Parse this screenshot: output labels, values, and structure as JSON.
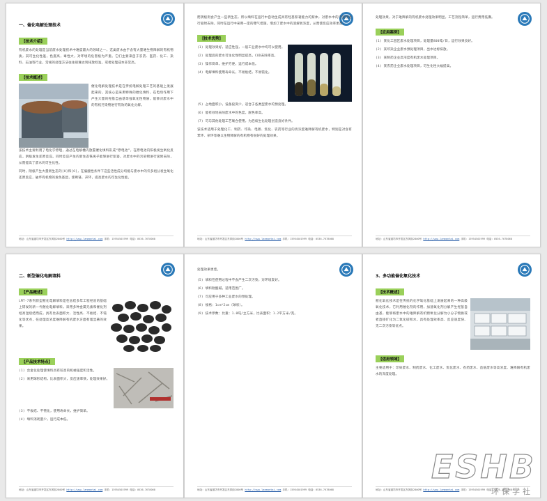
{
  "header_logo": "company-logo",
  "footer": {
    "prefix": "地址：",
    "address": "山东省潍坊市开发区东风街2800号",
    "contact_label": "联系人：",
    "url": "http://www.lanmantai.com",
    "phone_label": "手机：",
    "phone": "15954501999",
    "tel_label": "电话：",
    "tel": "0536-7678068"
  },
  "pages": {
    "p1": {
      "section": "一、催化电解处理技术",
      "tech_intro_label": "【技术介绍】",
      "intro_text": "有机废水的处理是当前废水处理技术中难度最大的领域之一，这类废水由于含有大量难生物降解的有机物质，其可生化性差，色度高，毒性大，对环境的危害极为严重。它们主要来自于农药、医药、化工、染料、石油等行业，常规的处理方法往往很难达到排放标准，或者处理成本非常高。",
      "principle_label": "【技术概述】",
      "principle_text_1": "催化电解处理技术是在传统电解处理工艺的基础上发展起来的，其核心是采用特殊的催化填料，在电场作用下产生大量的羟基自由基等强氧化性物质，能够对废水中的有机污染物进行有效的氧化分解。",
      "principle_text_2": "该技术主要利用了电化学原理，通过在电解槽内放置催化填料形成“原电池”，在原电池内阳极发生氧化反应，阴极发生还原反应。同时反应产生的新生态铁离子能够进行絮凝，对废水中的污染物进行吸附去除，从而提高了废水的可生化性。",
      "principle_text_3": "同时，阴极产生大量新生态的[H]和[O]，在偏酸性条件下这些活性成分均能与废水中的许多组分发生氧化还原反应，破坏有机物的发色基团，使断链、开环，提高废水的可生化性能。"
    },
    "p2": {
      "cont_text": "而阴极则会产生一些新生态，所以填料在运行中自动生成具有羟基絮凝能力的絮体，对废水中的污染物进行吸附去除，同时在运行中采用一定的曝气措施，增加了废水中的溶解氧浓度，从而使反应效率更高。",
      "advantage_label": "【技术优势】",
      "items": [
        "(1) 处理效果好，适应性强，一般工业废水中均可以使用。",
        "(2) 处理后的废水可生化性明显提高，COD去除率高。",
        "(3) 操作简单，维护方便，运行成本低。",
        "(4) 电解填料使用寿命长，不易板结，不易钝化。",
        "(5) 占地面积小，设备投资少，适合于各类型废水的预处理。",
        "(6) 能有效地去除废水中的色度，脱色率高。",
        "(7) 可与其他处理工艺联合使用，为后续生化处理创造良好条件。"
      ],
      "tail_text": "该技术适用于处理化工、制药、印染、电镀、焦化、农药等行业的高浓度难降解有机废水，特别是对含有苯环、杂环等难以生物降解的有机物有很好的处理效果。"
    },
    "p3": {
      "cont_text": "处理效果，对于难降解的有机废水处理效果明显，工艺流程简单，运行费用低廉。",
      "apply_label": "【应用案例】",
      "items": [
        "(1) 某化工园区废水处理项目，处理量800吨/日，运行效果良好。",
        "(2) 某印染企业废水预处理项目，出水达标排放。",
        "(3) 某制药企业高浓度有机废水处理项目。",
        "(4) 某农药企业废水处理项目，可生化性大幅提高。"
      ]
    },
    "p4": {
      "section": "二、新型催化电解填料",
      "product_label": "【产品概述】",
      "product_text": "LMT-7系列新型催化电解填料是在总结多年工程经验的基础上研发的新一代催化电解填料，采用多种金属元素和催化剂经高温烧结而成，具有比表面积大、活性高、不板结、不钝化等优点，在处理高浓度难降解有机废水方面有着显著的效果。",
      "feature_label": "【产品技术特点】",
      "items": [
        "(1) 合金化处理使填料具有较高的机械强度和活性。",
        "(2) 采用球形结构，比表面积大，反应速率快，处理效果好。",
        "(3) 不板结、不钝化，使用寿命长，维护简单。",
        "(4) 填料消耗量少，运行成本低。"
      ]
    },
    "p5": {
      "cont_text": "处理效果更佳。",
      "items": [
        "(5) 填料在使用过程中不会产生二次污染，对环境友好。",
        "(6) 填料耐酸碱，适用范围广。",
        "(7) 可应用于多种工业废水的预处理。",
        "(8) 规格：1cm*2cm（球状）。",
        "(9) 技术参数：比重：1.0吨/立方米，比表面积：1.2平方米/克。"
      ]
    },
    "p6": {
      "section": "3、多功能催化氧化技术",
      "intro_label": "【技术概述】",
      "intro_text": "催化氧化技术是在传统的化学氧化基础上发展起来的一种高级氧化技术，它利用催化剂的作用，加速氧化剂分解产生羟基自由基，能够将废水中的难降解有机物氧化分解为小分子物质或者直接矿化为二氧化碳和水，具有处理效率高、反应速度快、无二次污染等优点。",
      "field_label": "【适用领域】",
      "field_text": "主要适用于：印染废水、制药废水、化工废水、焦化废水、农药废水、造纸废水等高浓度、难降解有机废水的深度处理。"
    }
  },
  "watermark": {
    "brand": "ESHB",
    "sub": "环保学社"
  }
}
